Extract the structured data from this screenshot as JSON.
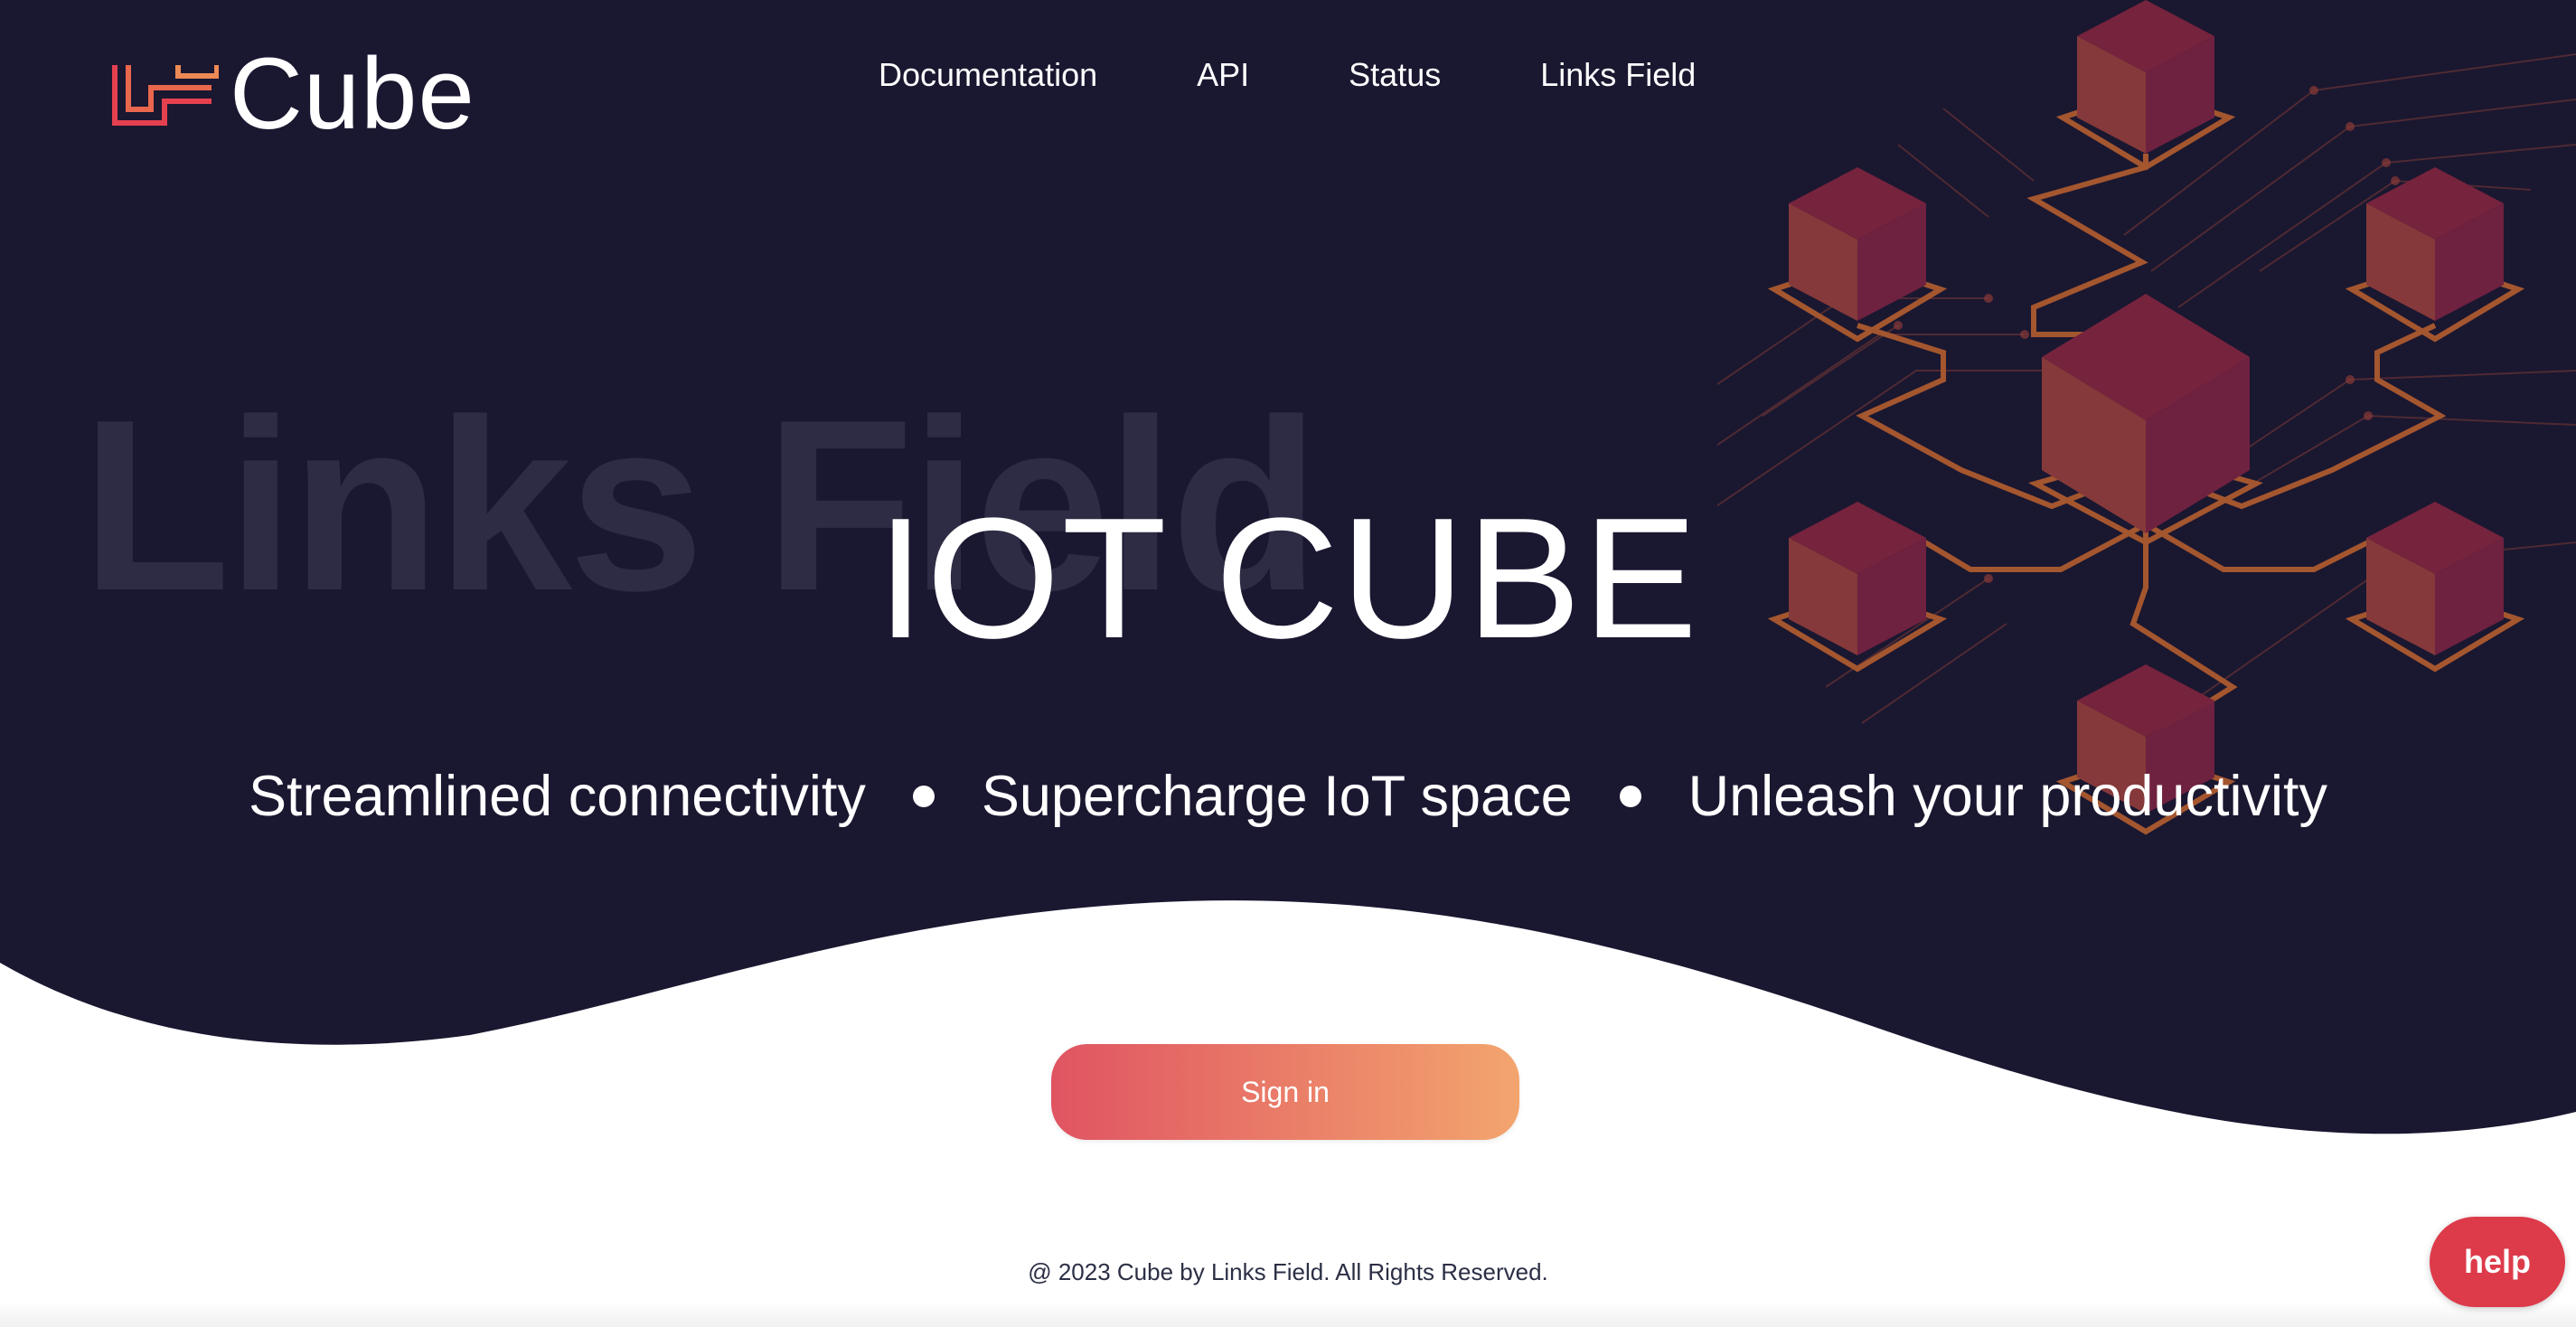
{
  "brand": {
    "name": "Cube"
  },
  "nav": {
    "items": [
      "Documentation",
      "API",
      "Status",
      "Links Field"
    ]
  },
  "hero": {
    "watermark": "Links Field",
    "title": "IOT CUBE",
    "taglines": [
      "Streamlined connectivity",
      "Supercharge IoT space",
      "Unleash your productivity"
    ]
  },
  "actions": {
    "sign_in_label": "Sign in"
  },
  "footer": {
    "copyright": "@ 2023 Cube by Links Field. All Rights Reserved."
  },
  "help": {
    "label": "help"
  },
  "colors": {
    "hero_background": "#1a1730",
    "accent_start": "#e05462",
    "accent_end": "#f3a56e",
    "help_button": "#dd3a4a",
    "cube_face": "#7a2440",
    "cube_side": "#8a3a37",
    "circuit": "#a4562f"
  },
  "icons": {
    "logo": "cube-logo-icon",
    "hero_art": "isometric-cubes-network-illustration"
  }
}
